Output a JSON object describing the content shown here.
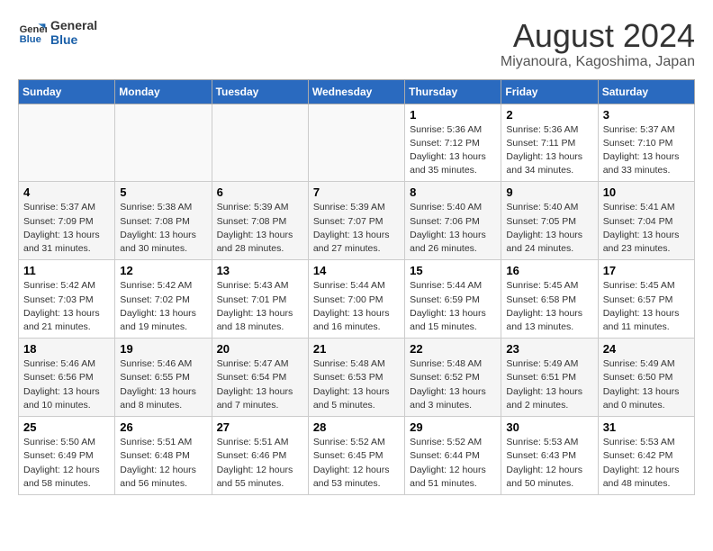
{
  "header": {
    "logo_line1": "General",
    "logo_line2": "Blue",
    "title": "August 2024",
    "subtitle": "Miyanoura, Kagoshima, Japan"
  },
  "days_of_week": [
    "Sunday",
    "Monday",
    "Tuesday",
    "Wednesday",
    "Thursday",
    "Friday",
    "Saturday"
  ],
  "weeks": [
    [
      {
        "day": "",
        "info": ""
      },
      {
        "day": "",
        "info": ""
      },
      {
        "day": "",
        "info": ""
      },
      {
        "day": "",
        "info": ""
      },
      {
        "day": "1",
        "info": "Sunrise: 5:36 AM\nSunset: 7:12 PM\nDaylight: 13 hours\nand 35 minutes."
      },
      {
        "day": "2",
        "info": "Sunrise: 5:36 AM\nSunset: 7:11 PM\nDaylight: 13 hours\nand 34 minutes."
      },
      {
        "day": "3",
        "info": "Sunrise: 5:37 AM\nSunset: 7:10 PM\nDaylight: 13 hours\nand 33 minutes."
      }
    ],
    [
      {
        "day": "4",
        "info": "Sunrise: 5:37 AM\nSunset: 7:09 PM\nDaylight: 13 hours\nand 31 minutes."
      },
      {
        "day": "5",
        "info": "Sunrise: 5:38 AM\nSunset: 7:08 PM\nDaylight: 13 hours\nand 30 minutes."
      },
      {
        "day": "6",
        "info": "Sunrise: 5:39 AM\nSunset: 7:08 PM\nDaylight: 13 hours\nand 28 minutes."
      },
      {
        "day": "7",
        "info": "Sunrise: 5:39 AM\nSunset: 7:07 PM\nDaylight: 13 hours\nand 27 minutes."
      },
      {
        "day": "8",
        "info": "Sunrise: 5:40 AM\nSunset: 7:06 PM\nDaylight: 13 hours\nand 26 minutes."
      },
      {
        "day": "9",
        "info": "Sunrise: 5:40 AM\nSunset: 7:05 PM\nDaylight: 13 hours\nand 24 minutes."
      },
      {
        "day": "10",
        "info": "Sunrise: 5:41 AM\nSunset: 7:04 PM\nDaylight: 13 hours\nand 23 minutes."
      }
    ],
    [
      {
        "day": "11",
        "info": "Sunrise: 5:42 AM\nSunset: 7:03 PM\nDaylight: 13 hours\nand 21 minutes."
      },
      {
        "day": "12",
        "info": "Sunrise: 5:42 AM\nSunset: 7:02 PM\nDaylight: 13 hours\nand 19 minutes."
      },
      {
        "day": "13",
        "info": "Sunrise: 5:43 AM\nSunset: 7:01 PM\nDaylight: 13 hours\nand 18 minutes."
      },
      {
        "day": "14",
        "info": "Sunrise: 5:44 AM\nSunset: 7:00 PM\nDaylight: 13 hours\nand 16 minutes."
      },
      {
        "day": "15",
        "info": "Sunrise: 5:44 AM\nSunset: 6:59 PM\nDaylight: 13 hours\nand 15 minutes."
      },
      {
        "day": "16",
        "info": "Sunrise: 5:45 AM\nSunset: 6:58 PM\nDaylight: 13 hours\nand 13 minutes."
      },
      {
        "day": "17",
        "info": "Sunrise: 5:45 AM\nSunset: 6:57 PM\nDaylight: 13 hours\nand 11 minutes."
      }
    ],
    [
      {
        "day": "18",
        "info": "Sunrise: 5:46 AM\nSunset: 6:56 PM\nDaylight: 13 hours\nand 10 minutes."
      },
      {
        "day": "19",
        "info": "Sunrise: 5:46 AM\nSunset: 6:55 PM\nDaylight: 13 hours\nand 8 minutes."
      },
      {
        "day": "20",
        "info": "Sunrise: 5:47 AM\nSunset: 6:54 PM\nDaylight: 13 hours\nand 7 minutes."
      },
      {
        "day": "21",
        "info": "Sunrise: 5:48 AM\nSunset: 6:53 PM\nDaylight: 13 hours\nand 5 minutes."
      },
      {
        "day": "22",
        "info": "Sunrise: 5:48 AM\nSunset: 6:52 PM\nDaylight: 13 hours\nand 3 minutes."
      },
      {
        "day": "23",
        "info": "Sunrise: 5:49 AM\nSunset: 6:51 PM\nDaylight: 13 hours\nand 2 minutes."
      },
      {
        "day": "24",
        "info": "Sunrise: 5:49 AM\nSunset: 6:50 PM\nDaylight: 13 hours\nand 0 minutes."
      }
    ],
    [
      {
        "day": "25",
        "info": "Sunrise: 5:50 AM\nSunset: 6:49 PM\nDaylight: 12 hours\nand 58 minutes."
      },
      {
        "day": "26",
        "info": "Sunrise: 5:51 AM\nSunset: 6:48 PM\nDaylight: 12 hours\nand 56 minutes."
      },
      {
        "day": "27",
        "info": "Sunrise: 5:51 AM\nSunset: 6:46 PM\nDaylight: 12 hours\nand 55 minutes."
      },
      {
        "day": "28",
        "info": "Sunrise: 5:52 AM\nSunset: 6:45 PM\nDaylight: 12 hours\nand 53 minutes."
      },
      {
        "day": "29",
        "info": "Sunrise: 5:52 AM\nSunset: 6:44 PM\nDaylight: 12 hours\nand 51 minutes."
      },
      {
        "day": "30",
        "info": "Sunrise: 5:53 AM\nSunset: 6:43 PM\nDaylight: 12 hours\nand 50 minutes."
      },
      {
        "day": "31",
        "info": "Sunrise: 5:53 AM\nSunset: 6:42 PM\nDaylight: 12 hours\nand 48 minutes."
      }
    ]
  ]
}
